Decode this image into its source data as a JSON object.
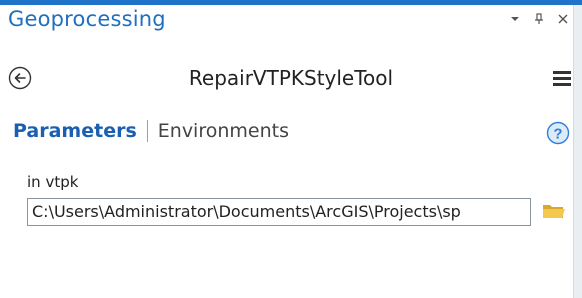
{
  "pane": {
    "title": "Geoprocessing",
    "controls": {
      "dropdown_icon": "chevron-down-icon",
      "pin_icon": "pin-icon",
      "close_icon": "close-icon"
    }
  },
  "tool": {
    "title": "RepairVTPKStyleTool",
    "back_icon": "back-arrow-icon",
    "menu_icon": "hamburger-menu-icon"
  },
  "tabs": {
    "parameters": "Parameters",
    "environments": "Environments",
    "active": "Parameters",
    "help_icon": "help-icon"
  },
  "parameters": [
    {
      "label": "in vtpk",
      "value": "C:\\Users\\Administrator\\Documents\\ArcGIS\\Projects\\sp",
      "browse_icon": "folder-icon"
    }
  ],
  "colors": {
    "accent": "#1f73c8",
    "title": "#1f6fbf",
    "active_tab": "#1a5fb0",
    "folder": "#e8b73a"
  }
}
